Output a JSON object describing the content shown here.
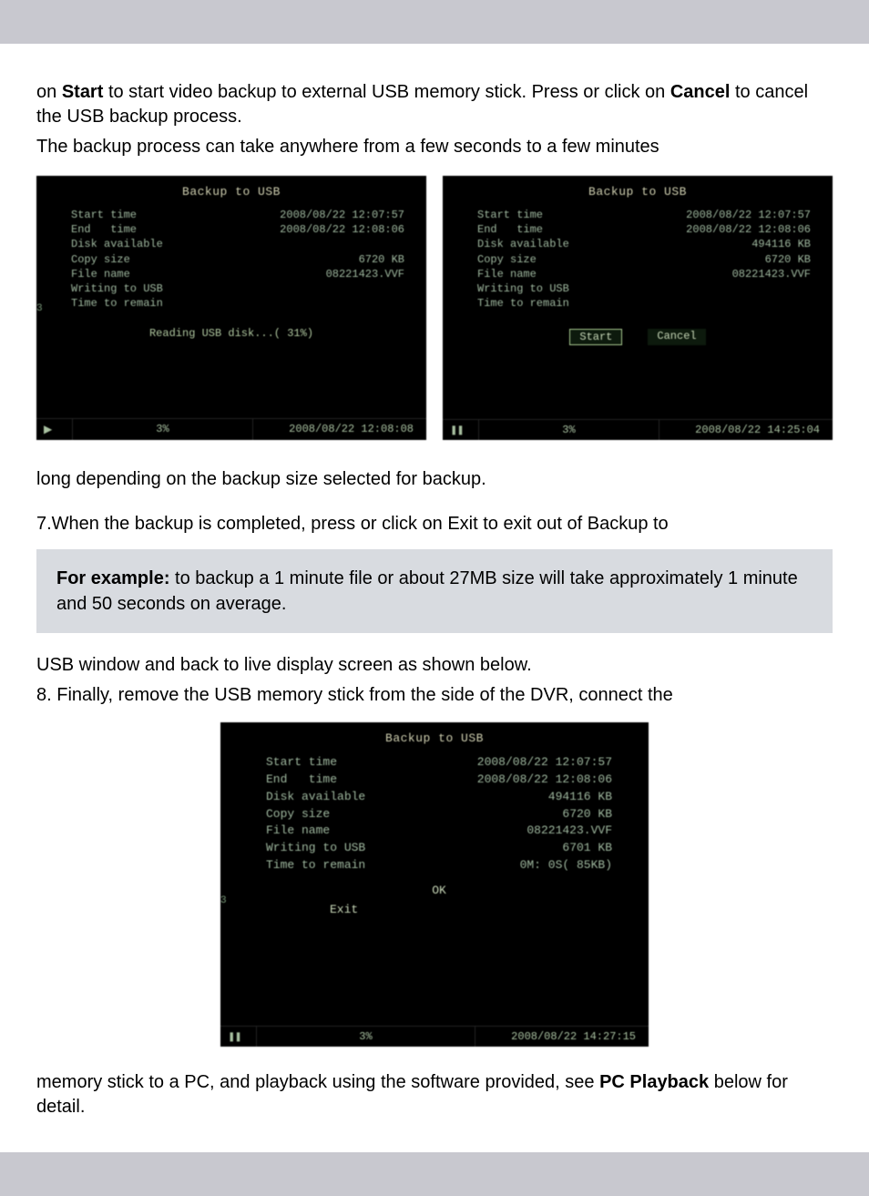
{
  "intro": {
    "line1_a": "on ",
    "line1_bold1": "Start",
    "line1_b": " to start video backup to external USB memory stick.  Press or click on ",
    "line1_bold2": "Cancel",
    "line1_c": " to cancel the USB backup process.",
    "line2": "The backup process can take anywhere from a few seconds to a few minutes"
  },
  "shot1": {
    "title": "Backup to USB",
    "rows": [
      {
        "k": "Start time",
        "v": "2008/08/22 12:07:57"
      },
      {
        "k": "End   time",
        "v": "2008/08/22 12:08:06"
      },
      {
        "k": "Disk available",
        "v": ""
      },
      {
        "k": "Copy size",
        "v": "6720 KB"
      },
      {
        "k": "File name",
        "v": "08221423.VVF"
      },
      {
        "k": "Writing to USB",
        "v": ""
      },
      {
        "k": "Time to remain",
        "v": ""
      }
    ],
    "mid": "Reading USB disk...( 31%)",
    "edge": "3",
    "status_icon": "play",
    "status_mid": "3%",
    "status_ts": "2008/08/22 12:08:08"
  },
  "shot2": {
    "title": "Backup to USB",
    "rows": [
      {
        "k": "Start time",
        "v": "2008/08/22 12:07:57"
      },
      {
        "k": "End   time",
        "v": "2008/08/22 12:08:06"
      },
      {
        "k": "Disk available",
        "v": "494116 KB"
      },
      {
        "k": "Copy size",
        "v": "6720 KB"
      },
      {
        "k": "File name",
        "v": "08221423.VVF"
      },
      {
        "k": "Writing to USB",
        "v": ""
      },
      {
        "k": "Time to remain",
        "v": ""
      }
    ],
    "btn_start": "Start",
    "btn_cancel": "Cancel",
    "status_icon": "pause",
    "status_mid": "3%",
    "status_ts": "2008/08/22 14:25:04"
  },
  "after1": "long depending on the backup size selected for backup.",
  "step7": "7.When the backup is completed, press or click on Exit to exit out of Backup to",
  "callout": {
    "lead": "For example:",
    "body": " to backup a 1 minute file or about 27MB size will take approximately 1 minute and 50 seconds on average."
  },
  "after2a": "USB window and back to live display screen as shown below.",
  "after2b": "8. Finally, remove the USB memory stick from the side of the DVR, connect the",
  "shot3": {
    "title": "Backup to USB",
    "rows": [
      {
        "k": "Start time",
        "v": "2008/08/22 12:07:57"
      },
      {
        "k": "End   time",
        "v": "2008/08/22 12:08:06"
      },
      {
        "k": "Disk available",
        "v": "494116 KB"
      },
      {
        "k": "Copy size",
        "v": "6720 KB"
      },
      {
        "k": "File name",
        "v": "08221423.VVF"
      },
      {
        "k": "Writing to USB",
        "v": "6701 KB"
      },
      {
        "k": "Time to remain",
        "v": "0M: 0S( 85KB)"
      }
    ],
    "ok": "OK",
    "exit": "Exit",
    "edge": "3",
    "status_icon": "pause",
    "status_mid": "3%",
    "status_ts": "2008/08/22 14:27:15"
  },
  "outro_a": "memory stick to a PC, and playback using the software provided, see ",
  "outro_bold": "PC Playback",
  "outro_b": " below for detail."
}
